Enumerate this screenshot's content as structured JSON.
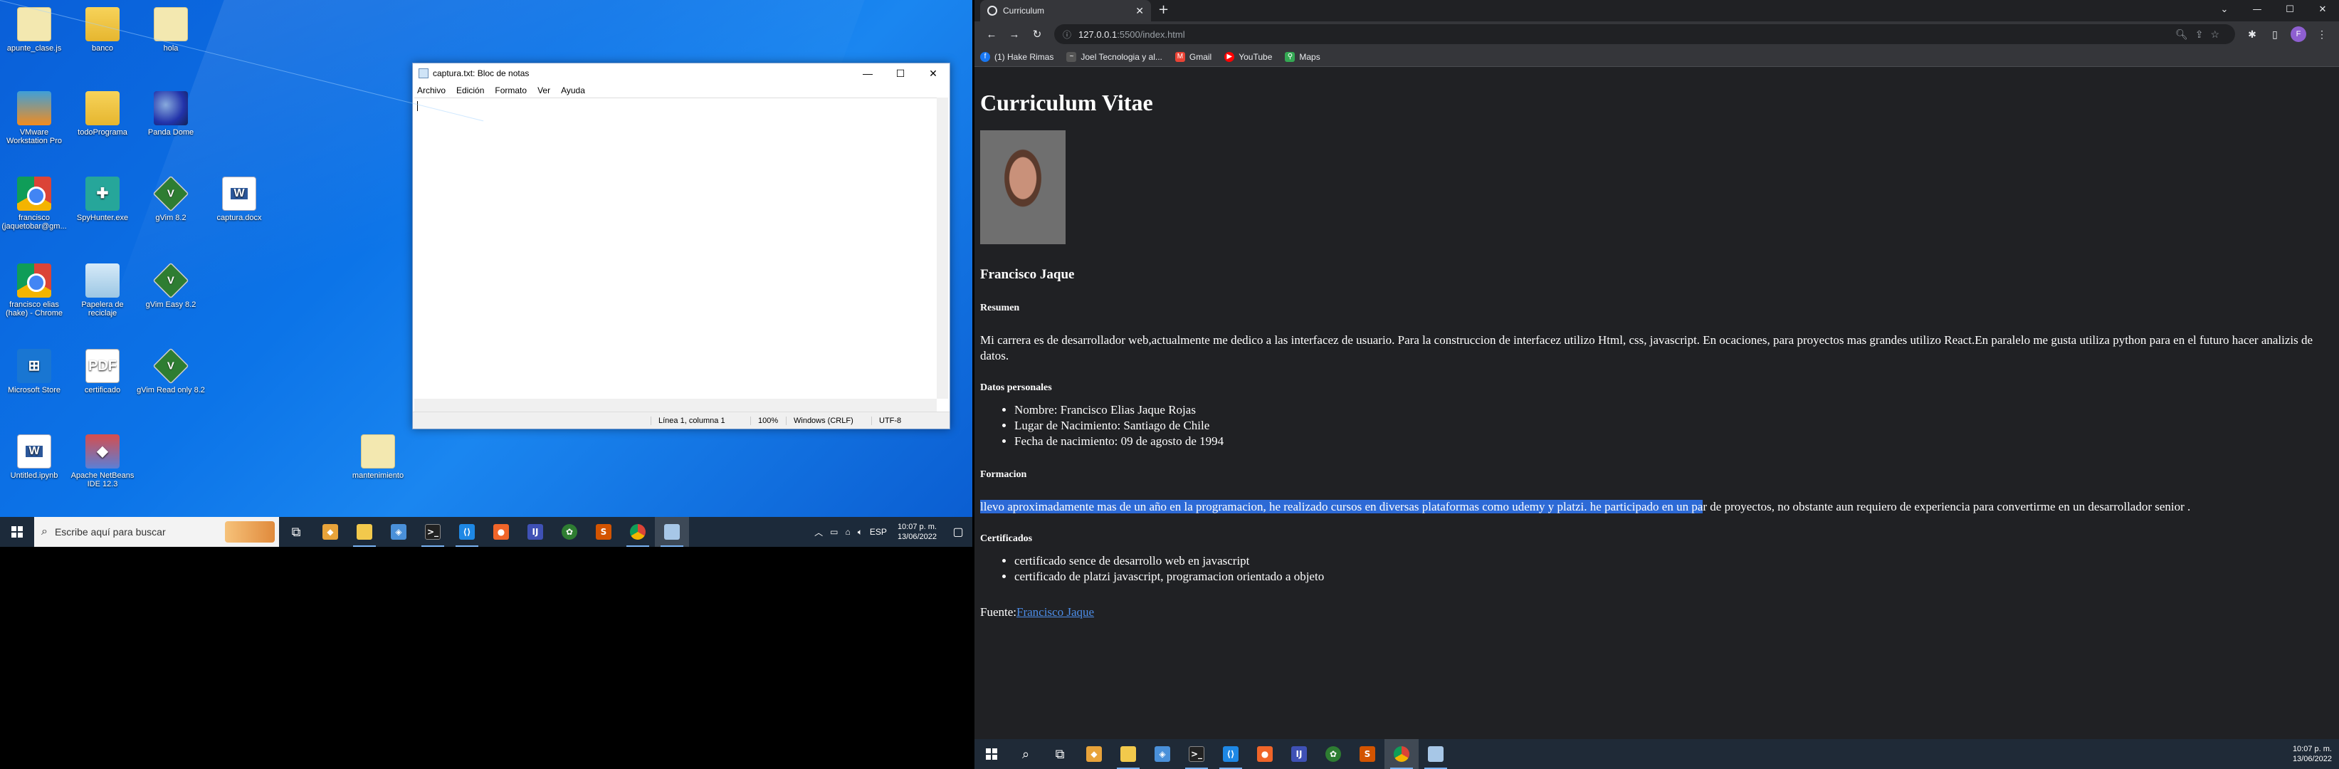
{
  "desktop": {
    "icons": [
      {
        "label": "apunte_clase.js",
        "icon": "file-icon"
      },
      {
        "label": "banco",
        "icon": "folder-icon"
      },
      {
        "label": "hola",
        "icon": "text-file-icon"
      },
      {
        "label": "VMware Workstation Pro",
        "icon": "vmware-icon"
      },
      {
        "label": "todoPrograma",
        "icon": "folder-icon"
      },
      {
        "label": "Panda Dome",
        "icon": "panda-icon"
      },
      {
        "label": "francisco (jaquetobar@gm...",
        "icon": "chrome-icon"
      },
      {
        "label": "SpyHunter.exe",
        "icon": "spyhunter-icon"
      },
      {
        "label": "gVim 8.2",
        "icon": "vim-icon"
      },
      {
        "label": "captura.docx",
        "icon": "word-icon"
      },
      {
        "label": "francisco elias (hake) - Chrome",
        "icon": "chrome-icon"
      },
      {
        "label": "Papelera de reciclaje",
        "icon": "recycle-bin-icon"
      },
      {
        "label": "gVim Easy 8.2",
        "icon": "vim-icon"
      },
      {
        "label": "Microsoft Store",
        "icon": "store-icon"
      },
      {
        "label": "certificado",
        "icon": "pdf-icon"
      },
      {
        "label": "gVim Read only 8.2",
        "icon": "vim-icon"
      },
      {
        "label": "Untitled.ipynb",
        "icon": "word-icon"
      },
      {
        "label": "Apache NetBeans IDE 12.3",
        "icon": "netbeans-icon"
      },
      {
        "label": "mantenimiento",
        "icon": "text-file-icon"
      }
    ]
  },
  "notepad": {
    "title": "captura.txt: Bloc de notas",
    "menu": [
      "Archivo",
      "Edición",
      "Formato",
      "Ver",
      "Ayuda"
    ],
    "status": {
      "position": "Línea 1, columna 1",
      "zoom": "100%",
      "eol": "Windows (CRLF)",
      "encoding": "UTF-8"
    }
  },
  "taskbar_left": {
    "search_placeholder": "Escribe aquí para buscar",
    "lang": "ESP",
    "time": "10:07 p. m.",
    "date": "13/06/2022"
  },
  "chrome": {
    "tab_title": "Curriculum",
    "url_host": "127.0.0.1",
    "url_path": ":5500/index.html",
    "bookmarks": [
      {
        "label": "(1) Hake Rimas",
        "color": "#1877f2",
        "glyph": "f"
      },
      {
        "label": "Joel Tecnologia y al...",
        "color": "#555555",
        "glyph": "~"
      },
      {
        "label": "Gmail",
        "color": "#ea4335",
        "glyph": "M"
      },
      {
        "label": "YouTube",
        "color": "#ff0000",
        "glyph": "▶"
      },
      {
        "label": "Maps",
        "color": "#34a853",
        "glyph": "⚲"
      }
    ],
    "profile_initial": "F"
  },
  "cv": {
    "title": "Curriculum Vitae",
    "name": "Francisco Jaque",
    "resumen_heading": "Resumen",
    "resumen_text": "Mi carrera es de desarrollador web,actualmente me dedico a las interfacez de usuario. Para la construccion de interfacez utilizo Html, css, javascript. En ocaciones, para proyectos mas grandes utilizo React.En paralelo me gusta utiliza python para en el futuro hacer analizis de datos.",
    "datos_heading": "Datos personales",
    "datos": [
      "Nombre: Francisco Elias Jaque Rojas",
      "Lugar de Nacimiento: Santiago de Chile",
      "Fecha de nacimiento: 09 de agosto de 1994"
    ],
    "formacion_heading": "Formacion",
    "formacion_selected": "llevo aproximadamente mas de un año en la programacion, he realizado cursos en diversas plataformas como udemy y platzi. he participado en un pa",
    "formacion_rest": "r de proyectos, no obstante aun requiero de experiencia para convertirme en un desarrollador senior .",
    "certificados_heading": "Certificados",
    "certificados": [
      "certificado sence de desarrollo web en javascript",
      "certificado de platzi javascript, programacion orientado a objeto"
    ],
    "fuente_label": "Fuente:",
    "fuente_link": "Francisco Jaque"
  },
  "taskbar_right": {
    "time": "10:07 p. m.",
    "date": "13/06/2022"
  },
  "colors": {
    "desktop_blue": "#0c74e8",
    "chrome_bg": "#202124",
    "selection": "#2d6ad6",
    "link": "#4c8de8"
  }
}
